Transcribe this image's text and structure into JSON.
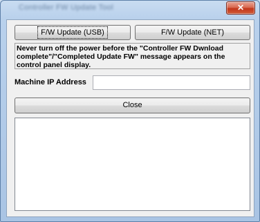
{
  "window": {
    "title": "Controller FW Update Tool",
    "close_glyph": "✕"
  },
  "toolbar": {
    "usb_label": "F/W Update (USB)",
    "net_label": "F/W Update (NET)"
  },
  "warning": {
    "text": "Never turn off the power before the \"Controller FW Dwnload complete\"/\"Completed Update FW\" message appears on the control panel display."
  },
  "ip": {
    "label": "Machine IP Address",
    "value": ""
  },
  "actions": {
    "close_label": "Close"
  },
  "log": {
    "text": ""
  }
}
